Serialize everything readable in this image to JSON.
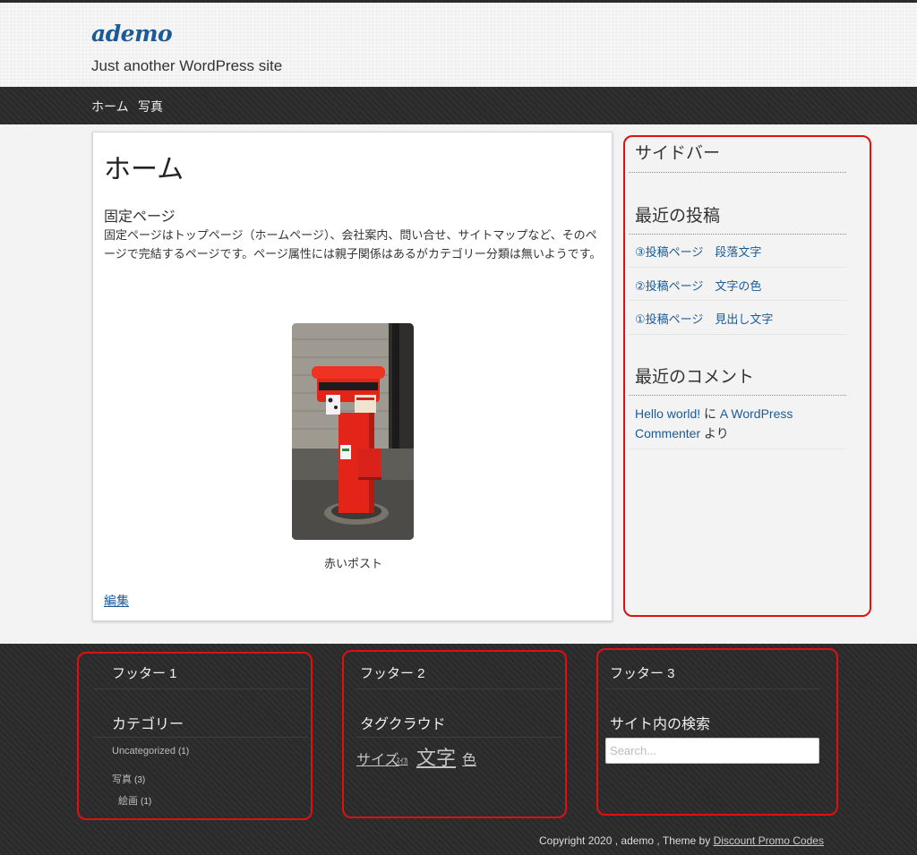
{
  "header": {
    "site_title": "ademo",
    "tagline": "Just another WordPress site"
  },
  "nav": {
    "items": [
      {
        "label": "ホーム"
      },
      {
        "label": "写真"
      }
    ]
  },
  "main": {
    "page_title": "ホーム",
    "section_heading": "固定ページ",
    "section_body": "固定ページはトップページ（ホームページ）、会社案内、問い合せ、サイトマップなど、そのページで完結するページです。ページ属性には親子関係はあるがカテゴリー分類は無いようです。",
    "image_caption": "赤いポスト",
    "edit_label": "編集"
  },
  "sidebar": {
    "title": "サイドバー",
    "recent_posts_title": "最近の投稿",
    "recent_posts": [
      "③投稿ページ　段落文字",
      "②投稿ページ　文字の色",
      "①投稿ページ　見出し文字"
    ],
    "recent_comments_title": "最近のコメント",
    "comment": {
      "post": "Hello world!",
      "on": " に ",
      "author": "A WordPress Commenter",
      "by": " より"
    }
  },
  "footer": {
    "col1": {
      "title": "フッター 1",
      "widget_title": "カテゴリー",
      "categories": [
        {
          "name": "Uncategorized",
          "count": "(1)"
        },
        {
          "name": "写真",
          "count": "(3)"
        },
        {
          "name": "絵画",
          "count": "(1)"
        }
      ]
    },
    "col2": {
      "title": "フッター 2",
      "widget_title": "タグクラウド",
      "tags": [
        "サイズ",
        "ｽｲｶ",
        "文字",
        "色"
      ]
    },
    "col3": {
      "title": "フッター 3",
      "widget_title": "サイト内の検索",
      "search_placeholder": "Search..."
    },
    "copyright": {
      "prefix": "Copyright 2020 , ademo , Theme by ",
      "link": "Discount Promo Codes"
    }
  },
  "colors": {
    "link": "#1c5a96",
    "highlight_outline": "#e01010",
    "dark_bar": "#2a2a2a",
    "mailbox_red": "#e32418"
  }
}
